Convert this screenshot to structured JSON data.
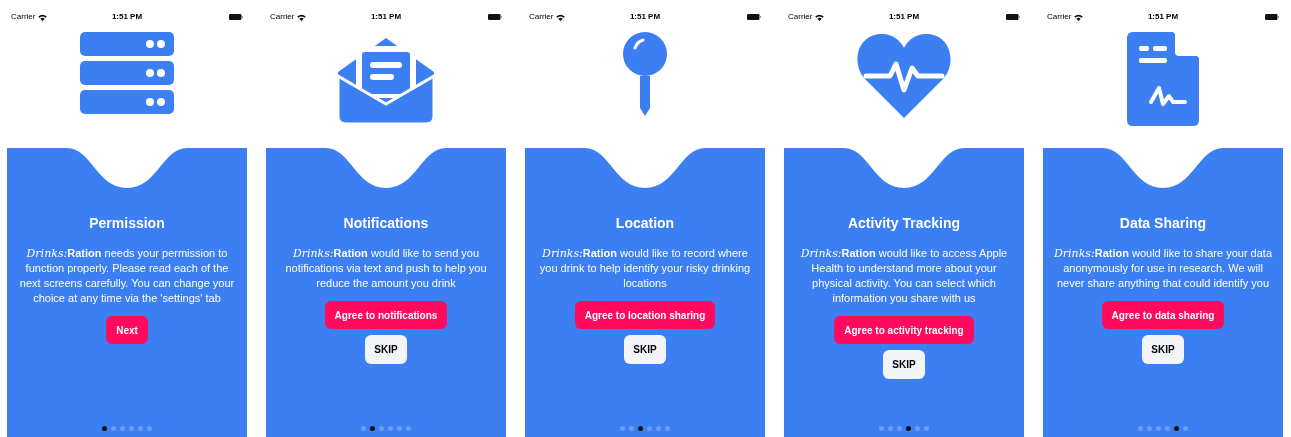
{
  "screens": [
    {
      "kind": "server",
      "status_bar": {
        "carrier": "Carrier",
        "time": "1:51 PM"
      },
      "title": "Permission",
      "brand_script": "Drinks:",
      "brand_bold": "Ration",
      "body": "needs your permission to function properly. Please read each of the next screens carefully. You can change your choice at any time via the 'settings' tab",
      "primary_button": "Next",
      "page_dots": [
        {
          "selected": true
        },
        {
          "selected": false
        },
        {
          "selected": false
        },
        {
          "selected": false
        },
        {
          "selected": false
        },
        {
          "selected": false
        }
      ]
    },
    {
      "kind": "mail",
      "status_bar": {
        "carrier": "Carrier",
        "time": "1:51 PM"
      },
      "title": "Notifications",
      "brand_script": "Drinks:",
      "brand_bold": "Ration",
      "body": "would like to send you notifications via text and push to help you reduce the amount you drink",
      "primary_button": "Agree to notifications",
      "skip_button": "SKIP",
      "page_dots": [
        {
          "selected": false
        },
        {
          "selected": true
        },
        {
          "selected": false
        },
        {
          "selected": false
        },
        {
          "selected": false
        },
        {
          "selected": false
        }
      ]
    },
    {
      "kind": "pin",
      "status_bar": {
        "carrier": "Carrier",
        "time": "1:51 PM"
      },
      "title": "Location",
      "brand_script": "Drinks:",
      "brand_bold": "Ration",
      "body": "would like to record where you drink to help identify your risky drinking locations",
      "primary_button": "Agree to location sharing",
      "skip_button": "SKIP",
      "page_dots": [
        {
          "selected": false
        },
        {
          "selected": false
        },
        {
          "selected": true
        },
        {
          "selected": false
        },
        {
          "selected": false
        },
        {
          "selected": false
        }
      ]
    },
    {
      "kind": "heart",
      "status_bar": {
        "carrier": "Carrier",
        "time": "1:51 PM"
      },
      "title": "Activity Tracking",
      "brand_script": "Drinks:",
      "brand_bold": "Ration",
      "body": "would like to access Apple Health to understand more about your physical activity. You can select which information you share with us",
      "primary_button": "Agree to activity tracking",
      "skip_button": "SKIP",
      "page_dots": [
        {
          "selected": false
        },
        {
          "selected": false
        },
        {
          "selected": false
        },
        {
          "selected": true
        },
        {
          "selected": false
        },
        {
          "selected": false
        }
      ]
    },
    {
      "kind": "document",
      "status_bar": {
        "carrier": "Carrier",
        "time": "1:51 PM"
      },
      "title": "Data Sharing",
      "brand_script": "Drinks:",
      "brand_bold": "Ration",
      "body": "would like to share your data anonymously for use in research. We will never share anything that could identify you",
      "primary_button": "Agree to data sharing",
      "skip_button": "SKIP",
      "page_dots": [
        {
          "selected": false
        },
        {
          "selected": false
        },
        {
          "selected": false
        },
        {
          "selected": false
        },
        {
          "selected": true
        },
        {
          "selected": false
        }
      ]
    }
  ]
}
